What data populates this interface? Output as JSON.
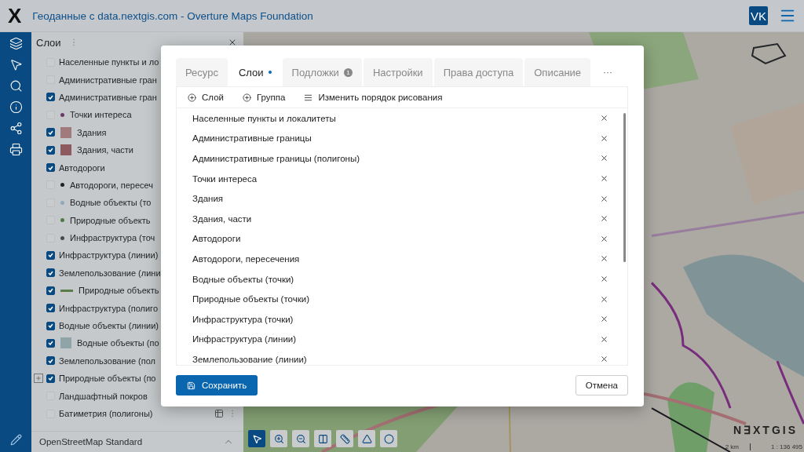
{
  "header": {
    "logo": "X",
    "title": "Геоданные с data.nextgis.com - Overture Maps Foundation",
    "avatar": "VK"
  },
  "layers_panel": {
    "title": "Слои",
    "items": [
      {
        "label": "Населенные пункты и ло",
        "checked": false
      },
      {
        "label": "Административные гран",
        "checked": false
      },
      {
        "label": "Административные гран",
        "checked": true
      },
      {
        "label": "Точки интереса",
        "checked": false,
        "symbol": {
          "kind": "dot",
          "color": "#6a3a6a"
        }
      },
      {
        "label": "Здания",
        "checked": true,
        "symbol": {
          "kind": "square",
          "color": "#a07a7c"
        }
      },
      {
        "label": "Здания, части",
        "checked": true,
        "symbol": {
          "kind": "square",
          "color": "#8d5a60"
        }
      },
      {
        "label": "Автодороги",
        "checked": true
      },
      {
        "label": "Автодороги, пересеч",
        "checked": false,
        "symbol": {
          "kind": "dot",
          "color": "#222222"
        }
      },
      {
        "label": "Водные объекты (то",
        "checked": false,
        "symbol": {
          "kind": "dot",
          "color": "#90a8b8"
        }
      },
      {
        "label": "Природные объекть",
        "checked": false,
        "symbol": {
          "kind": "dot",
          "color": "#4f7a45"
        }
      },
      {
        "label": "Инфраструктура (точ",
        "checked": false,
        "symbol": {
          "kind": "dot",
          "color": "#4a4a4a"
        }
      },
      {
        "label": "Инфраструктура (линии)",
        "checked": true
      },
      {
        "label": "Землепользование (лини",
        "checked": true
      },
      {
        "label": "Природные объекть",
        "checked": true,
        "symbol": {
          "kind": "line",
          "color": "#5a7d48"
        }
      },
      {
        "label": "Инфраструктура (полиго",
        "checked": true
      },
      {
        "label": "Водные объекты (линии)",
        "checked": true
      },
      {
        "label": "Водные объекты (по",
        "checked": true,
        "symbol": {
          "kind": "square",
          "color": "#8ea4a6"
        }
      },
      {
        "label": "Землепользование (пол",
        "checked": true
      },
      {
        "label": "Природные объекты (по",
        "checked": true,
        "expanded": false
      },
      {
        "label": "Ландшафтный покров",
        "checked": false
      },
      {
        "label": "Батиметрия (полигоны)",
        "checked": false,
        "hovered": true
      }
    ],
    "basemap": "OpenStreetMap Standard"
  },
  "dialog": {
    "tabs": [
      {
        "label": "Ресурс",
        "selected": false
      },
      {
        "label": "Слои",
        "selected": true,
        "dot": true
      },
      {
        "label": "Подложки",
        "selected": false,
        "badge": "1"
      },
      {
        "label": "Настройки",
        "selected": false
      },
      {
        "label": "Права доступа",
        "selected": false
      },
      {
        "label": "Описание",
        "selected": false
      }
    ],
    "more": "···",
    "toolbar": [
      {
        "kind": "add",
        "label": "Слой"
      },
      {
        "kind": "add",
        "label": "Группа"
      },
      {
        "kind": "order",
        "label": "Изменить порядок рисования"
      }
    ],
    "rows": [
      "Населенные пункты и локалитеты",
      "Административные границы",
      "Административные границы (полигоны)",
      "Точки интереса",
      "Здания",
      "Здания, части",
      "Автодороги",
      "Автодороги, пересечения",
      "Водные объекты (точки)",
      "Природные объекты (точки)",
      "Инфраструктура (точки)",
      "Инфраструктура (линии)",
      "Землепользование (линии)"
    ],
    "save": "Сохранить",
    "cancel": "Отмена"
  },
  "map": {
    "logo": "N∃XTGIS",
    "scale": "2 km",
    "ratio": "1 : 136 495"
  }
}
